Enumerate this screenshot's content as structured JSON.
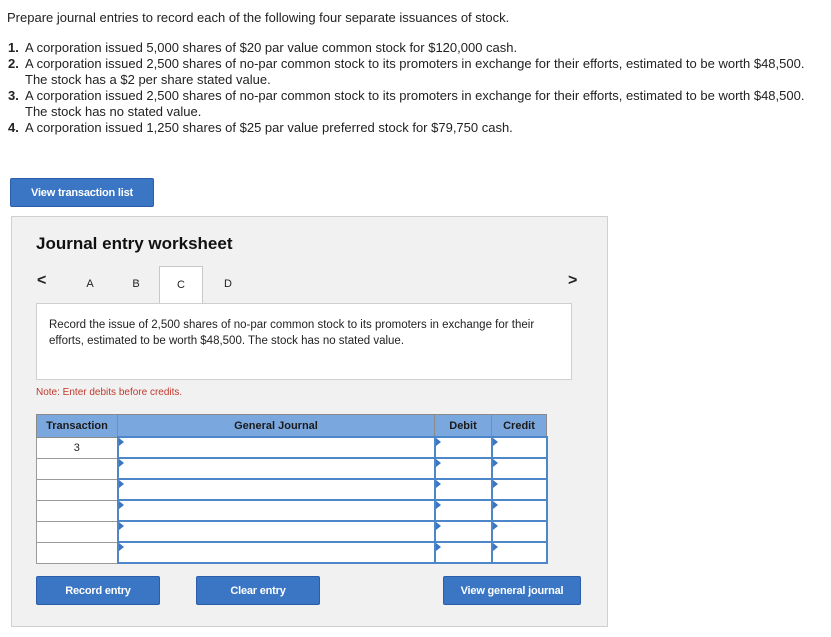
{
  "intro": "Prepare journal entries to record each of the following four separate issuances of stock.",
  "questions": [
    {
      "num": "1.",
      "text": "A corporation issued 5,000 shares of $20 par value common stock for $120,000 cash."
    },
    {
      "num": "2.",
      "text": "A corporation issued 2,500 shares of no-par common stock to its promoters in exchange for their efforts, estimated to be worth $48,500. The stock has a $2 per share stated value."
    },
    {
      "num": "3.",
      "text": "A corporation issued 2,500 shares of no-par common stock to its promoters in exchange for their efforts, estimated to be worth $48,500. The stock has no stated value."
    },
    {
      "num": "4.",
      "text": "A corporation issued 1,250 shares of $25 par value preferred stock for $79,750 cash."
    }
  ],
  "buttons": {
    "view_transactions": "View transaction list",
    "record_entry": "Record entry",
    "clear_entry": "Clear entry",
    "view_journal": "View general journal"
  },
  "worksheet": {
    "title": "Journal entry worksheet",
    "prev": "<",
    "next": ">",
    "tabs": [
      "A",
      "B",
      "C",
      "D"
    ],
    "active_tab": "C",
    "description": "Record the issue of 2,500 shares of no-par common stock to its promoters in exchange for their efforts, estimated to be worth $48,500. The stock has no stated value.",
    "note": "Note: Enter debits before credits."
  },
  "table": {
    "headers": {
      "transaction": "Transaction",
      "journal": "General Journal",
      "debit": "Debit",
      "credit": "Credit"
    },
    "rows": [
      {
        "transaction": "3",
        "journal": "",
        "debit": "",
        "credit": ""
      },
      {
        "transaction": "",
        "journal": "",
        "debit": "",
        "credit": ""
      },
      {
        "transaction": "",
        "journal": "",
        "debit": "",
        "credit": ""
      },
      {
        "transaction": "",
        "journal": "",
        "debit": "",
        "credit": ""
      },
      {
        "transaction": "",
        "journal": "",
        "debit": "",
        "credit": ""
      },
      {
        "transaction": "",
        "journal": "",
        "debit": "",
        "credit": ""
      }
    ]
  },
  "colors": {
    "button_bg": "#3a76c3",
    "header_bg": "#7aa7de",
    "note_text": "#c0392b"
  }
}
